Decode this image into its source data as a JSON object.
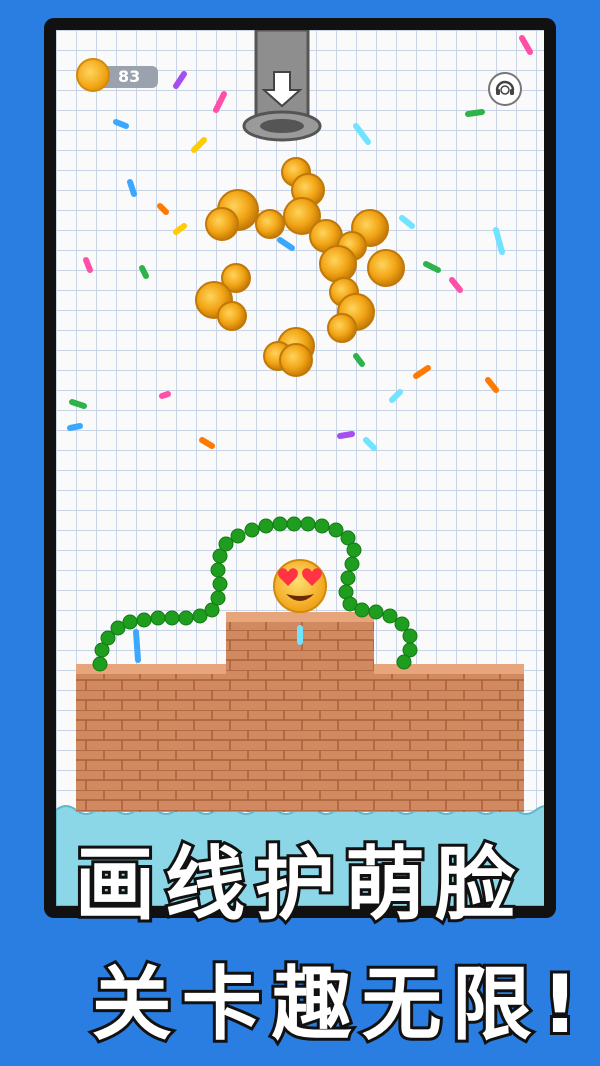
{
  "hud": {
    "coin_count": "83",
    "coin_icon": "coin-icon",
    "support_icon": "headset-support-icon"
  },
  "game": {
    "pipe_icon": "pipe-icon",
    "arrow_icon": "arrow-down-icon",
    "emoji": "heart-eyes-emoji",
    "colors": {
      "line": "#1e9d1e",
      "brick": "#d18a5f",
      "water": "#7fd3e6",
      "coin": "#f2a516"
    }
  },
  "promo": {
    "line1": "画线护萌脸",
    "line2": "关卡趣无限!"
  }
}
